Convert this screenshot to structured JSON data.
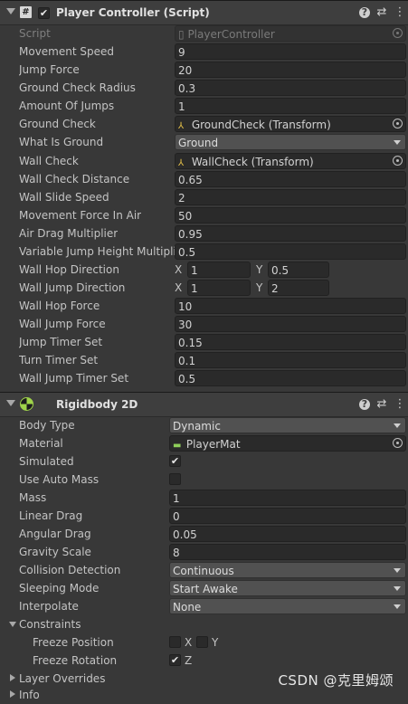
{
  "player_controller": {
    "title": "Player Controller (Script)",
    "enabled_check": "✔",
    "script_label": "Script",
    "script_value": "PlayerController",
    "fields": {
      "movement_speed": {
        "label": "Movement Speed",
        "value": "9"
      },
      "jump_force": {
        "label": "Jump Force",
        "value": "20"
      },
      "ground_check_radius": {
        "label": "Ground Check Radius",
        "value": "0.3"
      },
      "amount_of_jumps": {
        "label": "Amount Of Jumps",
        "value": "1"
      },
      "ground_check": {
        "label": "Ground Check",
        "value": "GroundCheck (Transform)"
      },
      "what_is_ground": {
        "label": "What Is Ground",
        "value": "Ground"
      },
      "wall_check": {
        "label": "Wall Check",
        "value": "WallCheck (Transform)"
      },
      "wall_check_distance": {
        "label": "Wall Check Distance",
        "value": "0.65"
      },
      "wall_slide_speed": {
        "label": "Wall Slide Speed",
        "value": "2"
      },
      "movement_force_in_air": {
        "label": "Movement Force In Air",
        "value": "50"
      },
      "air_drag_multiplier": {
        "label": "Air Drag Multiplier",
        "value": "0.95"
      },
      "variable_jump_height_multiplier": {
        "label": "Variable Jump Height Multiplie",
        "value": "0.5"
      },
      "wall_hop_direction": {
        "label": "Wall Hop Direction",
        "x_label": "X",
        "x": "1",
        "y_label": "Y",
        "y": "0.5"
      },
      "wall_jump_direction": {
        "label": "Wall Jump Direction",
        "x_label": "X",
        "x": "1",
        "y_label": "Y",
        "y": "2"
      },
      "wall_hop_force": {
        "label": "Wall Hop Force",
        "value": "10"
      },
      "wall_jump_force": {
        "label": "Wall Jump Force",
        "value": "30"
      },
      "jump_timer_set": {
        "label": "Jump Timer Set",
        "value": "0.15"
      },
      "turn_timer_set": {
        "label": "Turn Timer Set",
        "value": "0.1"
      },
      "wall_jump_timer_set": {
        "label": "Wall Jump Timer Set",
        "value": "0.5"
      }
    }
  },
  "rigidbody": {
    "title": "Rigidbody 2D",
    "body_type": {
      "label": "Body Type",
      "value": "Dynamic"
    },
    "material": {
      "label": "Material",
      "value": "PlayerMat"
    },
    "simulated": {
      "label": "Simulated",
      "checked": "✔"
    },
    "use_auto_mass": {
      "label": "Use Auto Mass",
      "checked": ""
    },
    "mass": {
      "label": "Mass",
      "value": "1"
    },
    "linear_drag": {
      "label": "Linear Drag",
      "value": "0"
    },
    "angular_drag": {
      "label": "Angular Drag",
      "value": "0.05"
    },
    "gravity_scale": {
      "label": "Gravity Scale",
      "value": "8"
    },
    "collision_detection": {
      "label": "Collision Detection",
      "value": "Continuous"
    },
    "sleeping_mode": {
      "label": "Sleeping Mode",
      "value": "Start Awake"
    },
    "interpolate": {
      "label": "Interpolate",
      "value": "None"
    },
    "constraints": {
      "label": "Constraints"
    },
    "freeze_position": {
      "label": "Freeze Position",
      "x_label": "X",
      "y_label": "Y",
      "x_checked": "",
      "y_checked": ""
    },
    "freeze_rotation": {
      "label": "Freeze Rotation",
      "z_label": "Z",
      "z_checked": "✔"
    },
    "layer_overrides": {
      "label": "Layer Overrides"
    },
    "info": {
      "label": "Info"
    }
  },
  "icons": {
    "help": "?",
    "presets": "⇄",
    "more": "⋮",
    "transform": "⅄",
    "material": "▬"
  },
  "watermark": "CSDN @克里姆颂",
  "colors": {
    "background": "#383838",
    "field": "#2a2a2a",
    "header": "#3e3e3e",
    "rigidbody_icon": "#9fd34a"
  }
}
